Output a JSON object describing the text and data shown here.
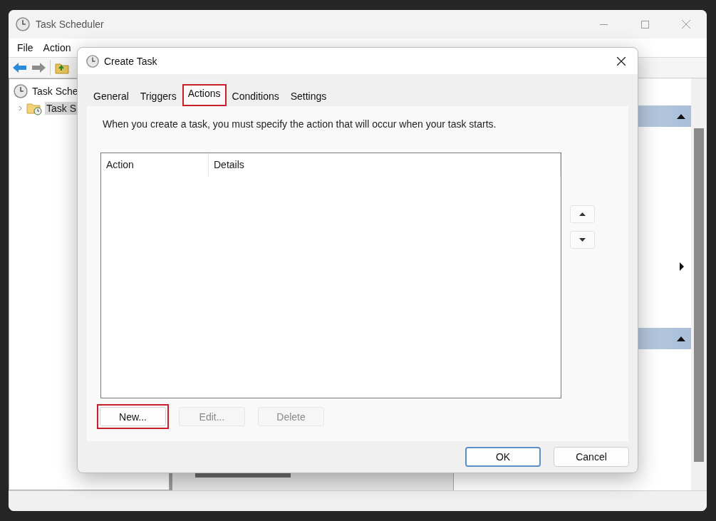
{
  "window": {
    "title": "Task Scheduler"
  },
  "menu": [
    {
      "label": "File"
    },
    {
      "label": "Action"
    }
  ],
  "tree": [
    {
      "label": "Task Sche",
      "children": [
        {
          "label": "Task S",
          "expanded": false,
          "selected": true
        }
      ]
    }
  ],
  "actions_pane": {
    "sections": [
      {
        "expanded": true
      },
      {
        "expanded": true
      }
    ]
  },
  "dialog": {
    "title": "Create Task",
    "tabs": [
      {
        "label": "General",
        "selected": false,
        "highlighted": false
      },
      {
        "label": "Triggers",
        "selected": false,
        "highlighted": false
      },
      {
        "label": "Actions",
        "selected": true,
        "highlighted": true
      },
      {
        "label": "Conditions",
        "selected": false,
        "highlighted": false
      },
      {
        "label": "Settings",
        "selected": false,
        "highlighted": false
      }
    ],
    "description": "When you create a task, you must specify the action that will occur when your task starts.",
    "list": {
      "columns": [
        "Action",
        "Details"
      ]
    },
    "list_buttons": [
      {
        "label": "New...",
        "disabled": false,
        "highlighted": true
      },
      {
        "label": "Edit...",
        "disabled": true,
        "highlighted": false
      },
      {
        "label": "Delete",
        "disabled": true,
        "highlighted": false
      }
    ],
    "footer_buttons": [
      {
        "label": "OK",
        "default": true
      },
      {
        "label": "Cancel",
        "default": false
      }
    ]
  }
}
